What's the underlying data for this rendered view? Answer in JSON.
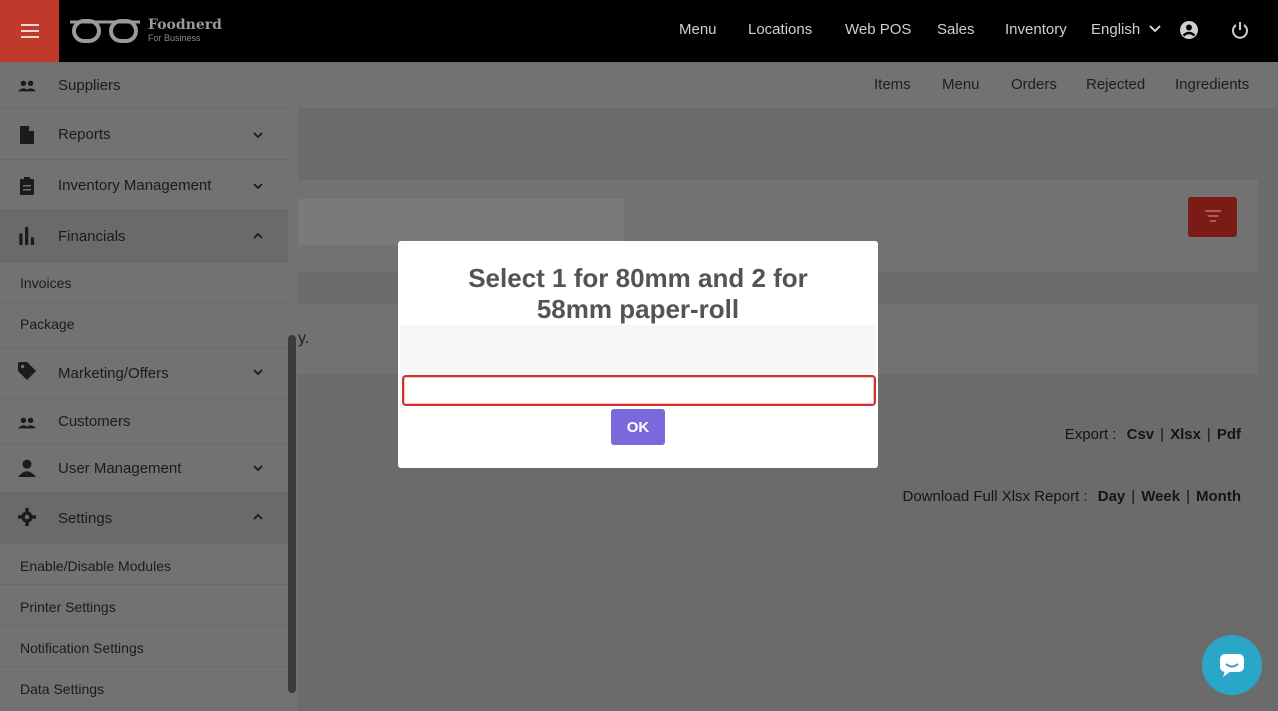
{
  "topbar": {
    "logo_name": "Foodnerd",
    "logo_sub": "For Business",
    "nav": [
      "Menu",
      "Locations",
      "Web POS",
      "Sales",
      "Inventory"
    ],
    "language": "English"
  },
  "subnav": [
    "Items",
    "Menu",
    "Orders",
    "Rejected",
    "Ingredients"
  ],
  "sidebar": {
    "items": [
      {
        "label": "Suppliers",
        "icon": "people-icon"
      },
      {
        "label": "Reports",
        "icon": "document-icon"
      },
      {
        "label": "Inventory Management",
        "icon": "clipboard-icon"
      },
      {
        "label": "Financials",
        "icon": "bar-chart-icon"
      },
      {
        "label": "Marketing/Offers",
        "icon": "tag-icon"
      },
      {
        "label": "Customers",
        "icon": "people-icon"
      },
      {
        "label": "User Management",
        "icon": "person-icon"
      },
      {
        "label": "Settings",
        "icon": "gear-icon"
      }
    ],
    "financials_sub": [
      "Invoices",
      "Package"
    ],
    "settings_sub": [
      "Enable/Disable Modules",
      "Printer Settings",
      "Notification Settings",
      "Data Settings"
    ]
  },
  "background": {
    "stray_text": "y.",
    "export_label": "Export :",
    "export_options": [
      "Csv",
      "Xlsx",
      "Pdf"
    ],
    "report_label": "Download Full Xlsx Report :",
    "report_options": [
      "Day",
      "Week",
      "Month"
    ]
  },
  "modal": {
    "title_line1": "Select 1 for 80mm and 2 for",
    "title_line2": "58mm paper-roll",
    "input_value": "",
    "ok_label": "OK"
  },
  "colors": {
    "brand_red": "#c0392b",
    "ok_purple": "#7b69dc",
    "chat_teal": "#2aa6c8",
    "input_error": "#d32f2f"
  }
}
